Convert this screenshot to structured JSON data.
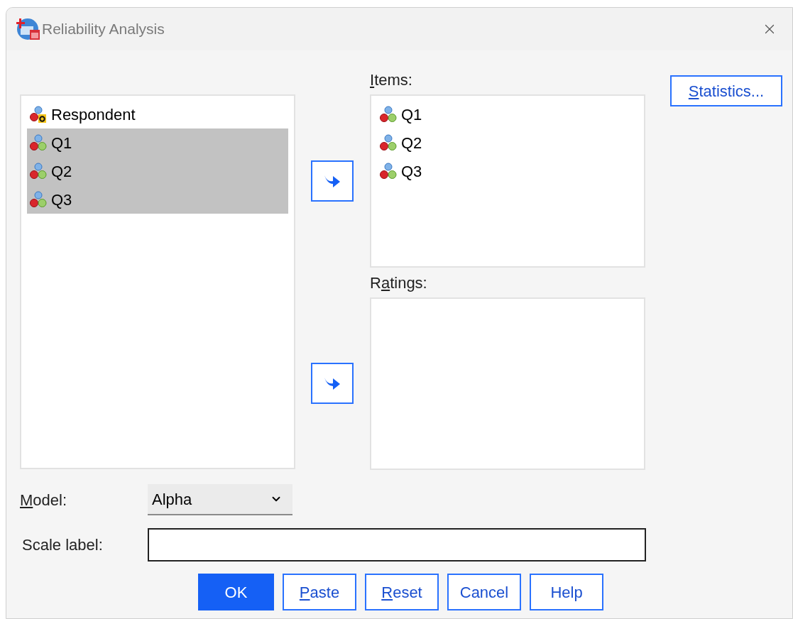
{
  "window": {
    "title": "Reliability Analysis"
  },
  "source_list": {
    "variables": [
      {
        "name": "Respondent",
        "kind": "string",
        "selected": false
      },
      {
        "name": "Q1",
        "kind": "scale",
        "selected": true
      },
      {
        "name": "Q2",
        "kind": "scale",
        "selected": true
      },
      {
        "name": "Q3",
        "kind": "scale",
        "selected": true
      }
    ]
  },
  "items": {
    "label": {
      "key": "I",
      "after": "tems:"
    },
    "variables": [
      {
        "name": "Q1",
        "kind": "scale",
        "selected": false
      },
      {
        "name": "Q2",
        "kind": "scale",
        "selected": false
      },
      {
        "name": "Q3",
        "kind": "scale",
        "selected": false
      }
    ]
  },
  "ratings": {
    "label": {
      "before": "R",
      "key": "a",
      "after": "tings:"
    }
  },
  "statistics_button": {
    "key": "S",
    "after": "tatistics..."
  },
  "model": {
    "label": {
      "key": "M",
      "after": "odel:"
    },
    "value": "Alpha"
  },
  "scale_label": {
    "label": {
      "text": "Scale label:"
    }
  },
  "buttons": [
    {
      "label": {
        "text": "OK"
      },
      "primary": true
    },
    {
      "label": {
        "key": "P",
        "after": "aste"
      },
      "primary": false
    },
    {
      "label": {
        "key": "R",
        "after": "eset"
      },
      "primary": false
    },
    {
      "label": {
        "text": "Cancel"
      },
      "primary": false
    },
    {
      "label": {
        "text": "Help"
      },
      "primary": false
    }
  ]
}
